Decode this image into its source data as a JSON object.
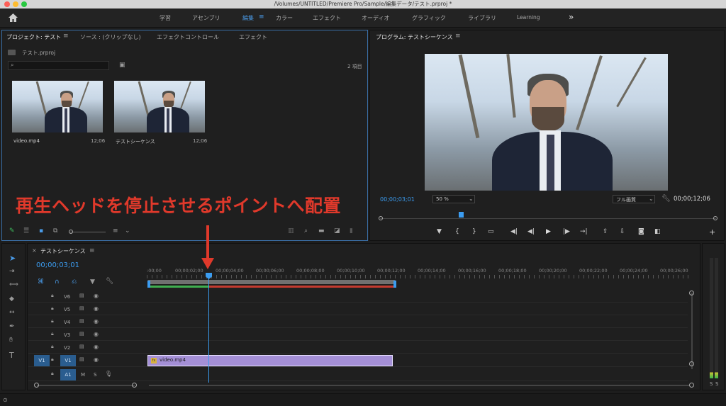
{
  "title_bar": {
    "path": "/Volumes/UNTITLED/Premiere Pro/Sample/編集データ/テスト.prproj *"
  },
  "workspace": {
    "items": [
      "学習",
      "アセンブリ",
      "編集",
      "カラー",
      "エフェクト",
      "オーディオ",
      "グラフィック",
      "ライブラリ",
      "Learning"
    ],
    "active": "編集",
    "more": "»"
  },
  "project_panel": {
    "tabs": [
      "プロジェクト: テスト",
      "ソース : (クリップなし)",
      "エフェクトコントロール",
      "エフェクト"
    ],
    "file": "テスト.prproj",
    "item_count": "2 項目",
    "items": [
      {
        "name": "video.mp4",
        "duration": "12;06"
      },
      {
        "name": "テストシーケンス",
        "duration": "12;06"
      }
    ]
  },
  "program_monitor": {
    "title": "プログラム: テストシーケンス",
    "zoom": "50 %",
    "quality": "フル画質",
    "timecode": "00;00;12;06",
    "current_time": "00;00;03;01"
  },
  "annotation": {
    "text": "再生ヘッドを停止させるポイントへ配置"
  },
  "timeline": {
    "title": "テストシーケンス",
    "timecode": "00;00;03;01",
    "ruler": [
      ":00;00",
      "00;00;02;00",
      "00;00;04;00",
      "00;00;06;00",
      "00;00;08;00",
      "00;00;10;00",
      "00;00;12;00",
      "00;00;14;00",
      "00;00;16;00",
      "00;00;18;00",
      "00;00;20;00",
      "00;00;22;00",
      "00;00;24;00",
      "00;00;26;00"
    ],
    "video_tracks": [
      "V6",
      "V5",
      "V4",
      "V3",
      "V2",
      "V1"
    ],
    "source_patch": "V1",
    "audio_patch": "A1",
    "audio_track": "A1",
    "audio_m": "M",
    "audio_s": "S",
    "clip_name": "video.mp4",
    "clip_badge": "fx",
    "playhead_fraction": 0.248
  },
  "meter": {
    "labels": [
      "S",
      "S"
    ]
  },
  "colors": {
    "accent_blue": "#2d8ceb",
    "annotation_red": "#e0392b",
    "clip_purple": "#a48fd6",
    "timecode_blue": "#3b9cf0"
  }
}
